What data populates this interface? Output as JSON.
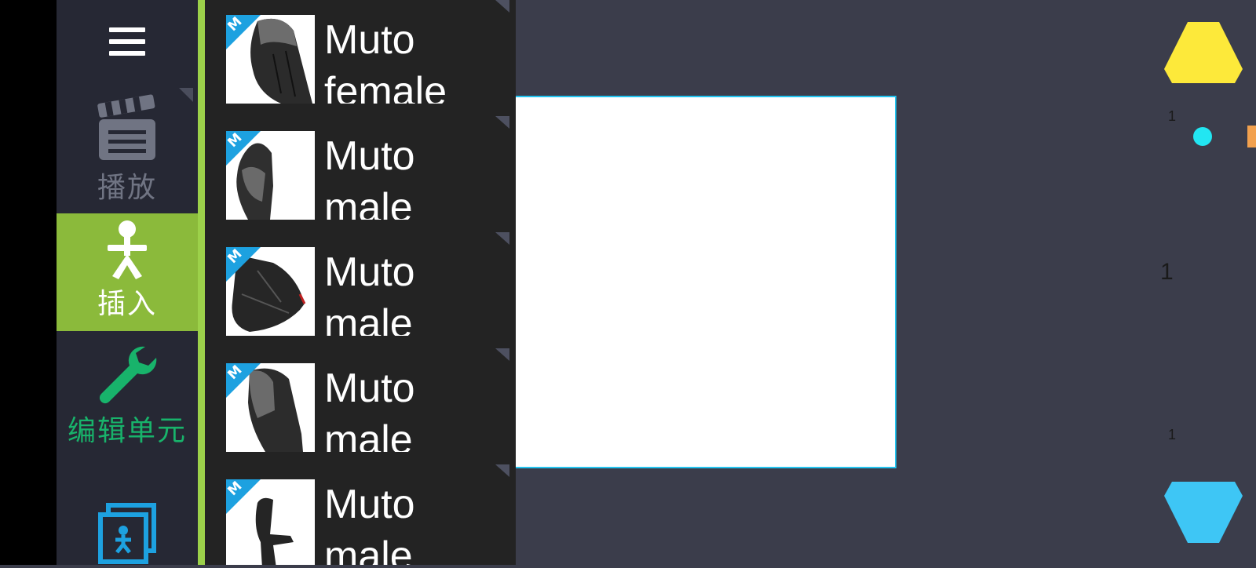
{
  "sidebar": {
    "menu_icon": "hamburger-menu-icon",
    "items": [
      {
        "label": "播放",
        "icon": "clapperboard-icon",
        "color": "#707483"
      },
      {
        "label": "插入",
        "icon": "stick-figure-icon",
        "color": "#ffffff",
        "active": true,
        "bg": "#8bba3b"
      },
      {
        "label": "编辑单元",
        "icon": "wrench-icon",
        "color": "#18b36b"
      },
      {
        "label": "",
        "icon": "photo-stack-icon",
        "color": "#1da1e0"
      }
    ]
  },
  "list": {
    "items": [
      {
        "badge": "M",
        "name": "Muto female"
      },
      {
        "badge": "M",
        "name": "Muto male"
      },
      {
        "badge": "M",
        "name": "Muto male"
      },
      {
        "badge": "M",
        "name": "Muto male"
      },
      {
        "badge": "M",
        "name": "Muto male"
      }
    ]
  },
  "timeline": {
    "top_marker": "1",
    "current_frame": "1",
    "bottom_marker": "1",
    "up_color": "#fde93a",
    "down_color": "#3ec6f5"
  }
}
